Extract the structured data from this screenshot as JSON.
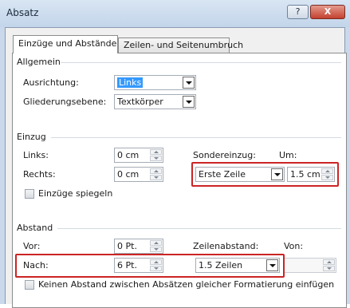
{
  "window": {
    "title": "Absatz",
    "help_label": "?",
    "close_label": "X"
  },
  "tabs": [
    {
      "label": "Einzüge und Abstände"
    },
    {
      "label": "Zeilen- und Seitenumbruch"
    }
  ],
  "allgemein": {
    "heading": "Allgemein",
    "ausrichtung": {
      "label": "Ausrichtung:",
      "value": "Links"
    },
    "gliederung": {
      "label": "Gliederungsebene:",
      "value": "Textkörper"
    }
  },
  "einzug": {
    "heading": "Einzug",
    "links": {
      "label": "Links:",
      "value": "0 cm"
    },
    "rechts": {
      "label": "Rechts:",
      "value": "0 cm"
    },
    "sondereinzug": {
      "label": "Sondereinzug:",
      "value": "Erste Zeile"
    },
    "um": {
      "label": "Um:",
      "value": "1.5 cm"
    },
    "spiegeln": {
      "label": "Einzüge spiegeln",
      "checked": false
    }
  },
  "abstand": {
    "heading": "Abstand",
    "vor": {
      "label": "Vor:",
      "value": "0 Pt."
    },
    "nach": {
      "label": "Nach:",
      "value": "6 Pt."
    },
    "zeilenabstand": {
      "label": "Zeilenabstand:",
      "value": "1.5 Zeilen"
    },
    "von": {
      "label": "Von:",
      "value": ""
    },
    "kein_abstand": {
      "label": "Keinen Abstand zwischen Absätzen gleicher Formatierung einfügen",
      "checked": false
    }
  },
  "colors": {
    "highlight_box": "#cc2424",
    "selection": "#3399ff",
    "titlebar": "#c9d8ea"
  }
}
